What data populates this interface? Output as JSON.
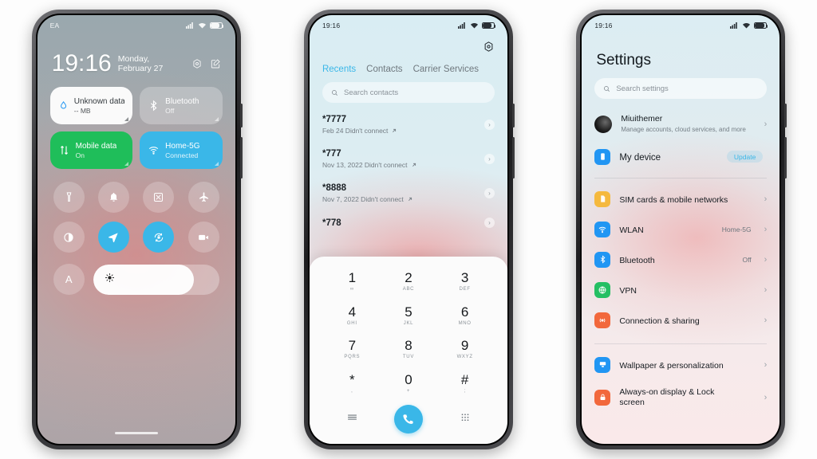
{
  "phone1": {
    "name": "control-center",
    "status": {
      "carrier": "EA",
      "signal_icon": "signal-bars-icon",
      "wifi_icon": "wifi-icon",
      "battery_icon": "battery-icon"
    },
    "clock": {
      "time": "19:16",
      "date": "Monday, February 27",
      "settings_icon": "gear-icon",
      "edit_icon": "edit-icon"
    },
    "tiles": [
      {
        "title": "Unknown data p",
        "sub": "-- MB",
        "icon": "water-drop-icon",
        "state": "light"
      },
      {
        "title": "Bluetooth",
        "sub": "Off",
        "icon": "bluetooth-icon",
        "state": "off"
      },
      {
        "title": "Mobile data",
        "sub": "On",
        "icon": "data-transfer-icon",
        "state": "green"
      },
      {
        "title": "Home-5G",
        "sub": "Connected",
        "icon": "wifi-icon",
        "state": "blue"
      }
    ],
    "toggles": [
      {
        "name": "flashlight-toggle",
        "icon": "flashlight-icon",
        "on": false
      },
      {
        "name": "silent-toggle",
        "icon": "bell-icon",
        "on": false
      },
      {
        "name": "screenshot-toggle",
        "icon": "screenshot-icon",
        "on": false
      },
      {
        "name": "airplane-mode-toggle",
        "icon": "airplane-icon",
        "on": false
      },
      {
        "name": "dark-mode-toggle",
        "icon": "contrast-icon",
        "on": false
      },
      {
        "name": "location-toggle",
        "icon": "location-arrow-icon",
        "on": true
      },
      {
        "name": "rotation-lock-toggle",
        "icon": "rotation-lock-icon",
        "on": true
      },
      {
        "name": "screen-record-toggle",
        "icon": "video-camera-icon",
        "on": false
      }
    ],
    "brightness": {
      "auto_label": "A",
      "icon": "brightness-sun-icon",
      "level_percent": 80
    }
  },
  "phone2": {
    "name": "dialer",
    "status": {
      "time": "19:16",
      "signal_icon": "signal-bars-icon",
      "wifi_icon": "wifi-icon",
      "battery_icon": "battery-icon"
    },
    "gear_icon": "gear-icon",
    "tabs": [
      {
        "label": "Recents",
        "active": true
      },
      {
        "label": "Contacts",
        "active": false
      },
      {
        "label": "Carrier Services",
        "active": false
      }
    ],
    "search": {
      "placeholder": "Search contacts",
      "icon": "search-icon"
    },
    "calls": [
      {
        "number": "*7777",
        "meta": "Feb 24 Didn't connect",
        "arrow": "outgoing-arrow-icon"
      },
      {
        "number": "*777",
        "meta": "Nov 13, 2022 Didn't connect",
        "arrow": "outgoing-arrow-icon"
      },
      {
        "number": "*8888",
        "meta": "Nov 7, 2022 Didn't connect",
        "arrow": "outgoing-arrow-icon"
      },
      {
        "number": "*778",
        "meta": "",
        "arrow": "outgoing-arrow-icon"
      }
    ],
    "keypad": [
      {
        "digit": "1",
        "sub": "∞"
      },
      {
        "digit": "2",
        "sub": "ABC"
      },
      {
        "digit": "3",
        "sub": "DEF"
      },
      {
        "digit": "4",
        "sub": "GHI"
      },
      {
        "digit": "5",
        "sub": "JKL"
      },
      {
        "digit": "6",
        "sub": "MNO"
      },
      {
        "digit": "7",
        "sub": "PQRS"
      },
      {
        "digit": "8",
        "sub": "TUV"
      },
      {
        "digit": "9",
        "sub": "WXYZ"
      },
      {
        "digit": "*",
        "sub": ","
      },
      {
        "digit": "0",
        "sub": "+"
      },
      {
        "digit": "#",
        "sub": ";"
      }
    ],
    "keypad_actions": {
      "menu_icon": "hamburger-menu-icon",
      "call_icon": "phone-handset-icon",
      "dialpad_icon": "dialpad-grid-icon"
    }
  },
  "phone3": {
    "name": "settings",
    "status": {
      "time": "19:16",
      "signal_icon": "signal-bars-icon",
      "wifi_icon": "wifi-icon",
      "battery_icon": "battery-icon"
    },
    "title": "Settings",
    "search": {
      "placeholder": "Search settings",
      "icon": "search-icon"
    },
    "account": {
      "name": "Miuithemer",
      "sub": "Manage accounts, cloud services, and more",
      "avatar": "user-avatar"
    },
    "device": {
      "label": "My device",
      "badge": "Update",
      "icon": "phone-device-icon",
      "color": "#2196f3"
    },
    "groups": [
      {
        "items": [
          {
            "label": "SIM cards & mobile networks",
            "value": "",
            "icon": "sim-card-icon",
            "color": "#f5b93e"
          },
          {
            "label": "WLAN",
            "value": "Home-5G",
            "icon": "wifi-icon",
            "color": "#2196f3"
          },
          {
            "label": "Bluetooth",
            "value": "Off",
            "icon": "bluetooth-icon",
            "color": "#2196f3"
          },
          {
            "label": "VPN",
            "value": "",
            "icon": "globe-icon",
            "color": "#25bf63"
          },
          {
            "label": "Connection & sharing",
            "value": "",
            "icon": "broadcast-icon",
            "color": "#f2683c"
          }
        ]
      },
      {
        "items": [
          {
            "label": "Wallpaper & personalization",
            "value": "",
            "icon": "wallpaper-icon",
            "color": "#2196f3"
          },
          {
            "label": "Always-on display & Lock screen",
            "value": "",
            "icon": "lock-icon",
            "color": "#f2683c"
          }
        ]
      }
    ],
    "chevron_icon": "chevron-right-icon"
  }
}
